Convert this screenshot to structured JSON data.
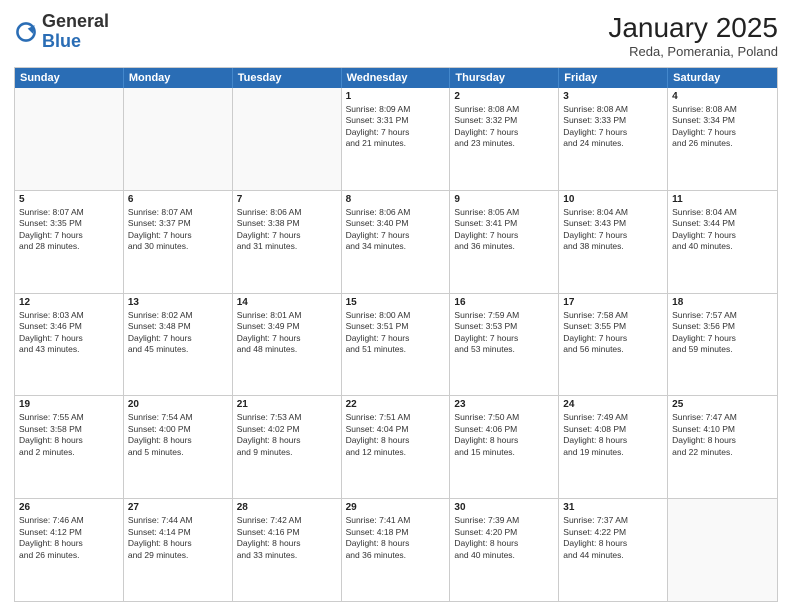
{
  "header": {
    "logo_general": "General",
    "logo_blue": "Blue",
    "title": "January 2025",
    "subtitle": "Reda, Pomerania, Poland"
  },
  "weekdays": [
    "Sunday",
    "Monday",
    "Tuesday",
    "Wednesday",
    "Thursday",
    "Friday",
    "Saturday"
  ],
  "rows": [
    [
      {
        "day": "",
        "info": ""
      },
      {
        "day": "",
        "info": ""
      },
      {
        "day": "",
        "info": ""
      },
      {
        "day": "1",
        "info": "Sunrise: 8:09 AM\nSunset: 3:31 PM\nDaylight: 7 hours\nand 21 minutes."
      },
      {
        "day": "2",
        "info": "Sunrise: 8:08 AM\nSunset: 3:32 PM\nDaylight: 7 hours\nand 23 minutes."
      },
      {
        "day": "3",
        "info": "Sunrise: 8:08 AM\nSunset: 3:33 PM\nDaylight: 7 hours\nand 24 minutes."
      },
      {
        "day": "4",
        "info": "Sunrise: 8:08 AM\nSunset: 3:34 PM\nDaylight: 7 hours\nand 26 minutes."
      }
    ],
    [
      {
        "day": "5",
        "info": "Sunrise: 8:07 AM\nSunset: 3:35 PM\nDaylight: 7 hours\nand 28 minutes."
      },
      {
        "day": "6",
        "info": "Sunrise: 8:07 AM\nSunset: 3:37 PM\nDaylight: 7 hours\nand 30 minutes."
      },
      {
        "day": "7",
        "info": "Sunrise: 8:06 AM\nSunset: 3:38 PM\nDaylight: 7 hours\nand 31 minutes."
      },
      {
        "day": "8",
        "info": "Sunrise: 8:06 AM\nSunset: 3:40 PM\nDaylight: 7 hours\nand 34 minutes."
      },
      {
        "day": "9",
        "info": "Sunrise: 8:05 AM\nSunset: 3:41 PM\nDaylight: 7 hours\nand 36 minutes."
      },
      {
        "day": "10",
        "info": "Sunrise: 8:04 AM\nSunset: 3:43 PM\nDaylight: 7 hours\nand 38 minutes."
      },
      {
        "day": "11",
        "info": "Sunrise: 8:04 AM\nSunset: 3:44 PM\nDaylight: 7 hours\nand 40 minutes."
      }
    ],
    [
      {
        "day": "12",
        "info": "Sunrise: 8:03 AM\nSunset: 3:46 PM\nDaylight: 7 hours\nand 43 minutes."
      },
      {
        "day": "13",
        "info": "Sunrise: 8:02 AM\nSunset: 3:48 PM\nDaylight: 7 hours\nand 45 minutes."
      },
      {
        "day": "14",
        "info": "Sunrise: 8:01 AM\nSunset: 3:49 PM\nDaylight: 7 hours\nand 48 minutes."
      },
      {
        "day": "15",
        "info": "Sunrise: 8:00 AM\nSunset: 3:51 PM\nDaylight: 7 hours\nand 51 minutes."
      },
      {
        "day": "16",
        "info": "Sunrise: 7:59 AM\nSunset: 3:53 PM\nDaylight: 7 hours\nand 53 minutes."
      },
      {
        "day": "17",
        "info": "Sunrise: 7:58 AM\nSunset: 3:55 PM\nDaylight: 7 hours\nand 56 minutes."
      },
      {
        "day": "18",
        "info": "Sunrise: 7:57 AM\nSunset: 3:56 PM\nDaylight: 7 hours\nand 59 minutes."
      }
    ],
    [
      {
        "day": "19",
        "info": "Sunrise: 7:55 AM\nSunset: 3:58 PM\nDaylight: 8 hours\nand 2 minutes."
      },
      {
        "day": "20",
        "info": "Sunrise: 7:54 AM\nSunset: 4:00 PM\nDaylight: 8 hours\nand 5 minutes."
      },
      {
        "day": "21",
        "info": "Sunrise: 7:53 AM\nSunset: 4:02 PM\nDaylight: 8 hours\nand 9 minutes."
      },
      {
        "day": "22",
        "info": "Sunrise: 7:51 AM\nSunset: 4:04 PM\nDaylight: 8 hours\nand 12 minutes."
      },
      {
        "day": "23",
        "info": "Sunrise: 7:50 AM\nSunset: 4:06 PM\nDaylight: 8 hours\nand 15 minutes."
      },
      {
        "day": "24",
        "info": "Sunrise: 7:49 AM\nSunset: 4:08 PM\nDaylight: 8 hours\nand 19 minutes."
      },
      {
        "day": "25",
        "info": "Sunrise: 7:47 AM\nSunset: 4:10 PM\nDaylight: 8 hours\nand 22 minutes."
      }
    ],
    [
      {
        "day": "26",
        "info": "Sunrise: 7:46 AM\nSunset: 4:12 PM\nDaylight: 8 hours\nand 26 minutes."
      },
      {
        "day": "27",
        "info": "Sunrise: 7:44 AM\nSunset: 4:14 PM\nDaylight: 8 hours\nand 29 minutes."
      },
      {
        "day": "28",
        "info": "Sunrise: 7:42 AM\nSunset: 4:16 PM\nDaylight: 8 hours\nand 33 minutes."
      },
      {
        "day": "29",
        "info": "Sunrise: 7:41 AM\nSunset: 4:18 PM\nDaylight: 8 hours\nand 36 minutes."
      },
      {
        "day": "30",
        "info": "Sunrise: 7:39 AM\nSunset: 4:20 PM\nDaylight: 8 hours\nand 40 minutes."
      },
      {
        "day": "31",
        "info": "Sunrise: 7:37 AM\nSunset: 4:22 PM\nDaylight: 8 hours\nand 44 minutes."
      },
      {
        "day": "",
        "info": ""
      }
    ]
  ]
}
